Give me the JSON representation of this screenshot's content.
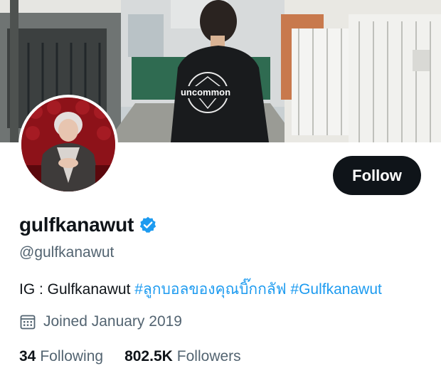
{
  "profile": {
    "display_name": "gulfkanawut",
    "handle": "@gulfkanawut",
    "bio_prefix": "IG : Gulfkanawut ",
    "bio_hashtags": [
      "#ลูกบอลของคุณบิ๊กกลัฟ",
      "#Gulfkanawut"
    ],
    "joined": "Joined January 2019",
    "following_count": "34",
    "following_label": "Following",
    "followers_count": "802.5K",
    "followers_label": "Followers",
    "verified": true
  },
  "follow_button": {
    "label": "Follow"
  },
  "banner": {
    "jacket_text": "uncommon"
  },
  "icons": {
    "verified": "verified-badge-icon",
    "calendar": "calendar-icon"
  },
  "colors": {
    "accent": "#1d9bf0",
    "text_primary": "#0f1419",
    "text_secondary": "#536471",
    "button_bg": "#0f1419",
    "button_text": "#ffffff"
  }
}
